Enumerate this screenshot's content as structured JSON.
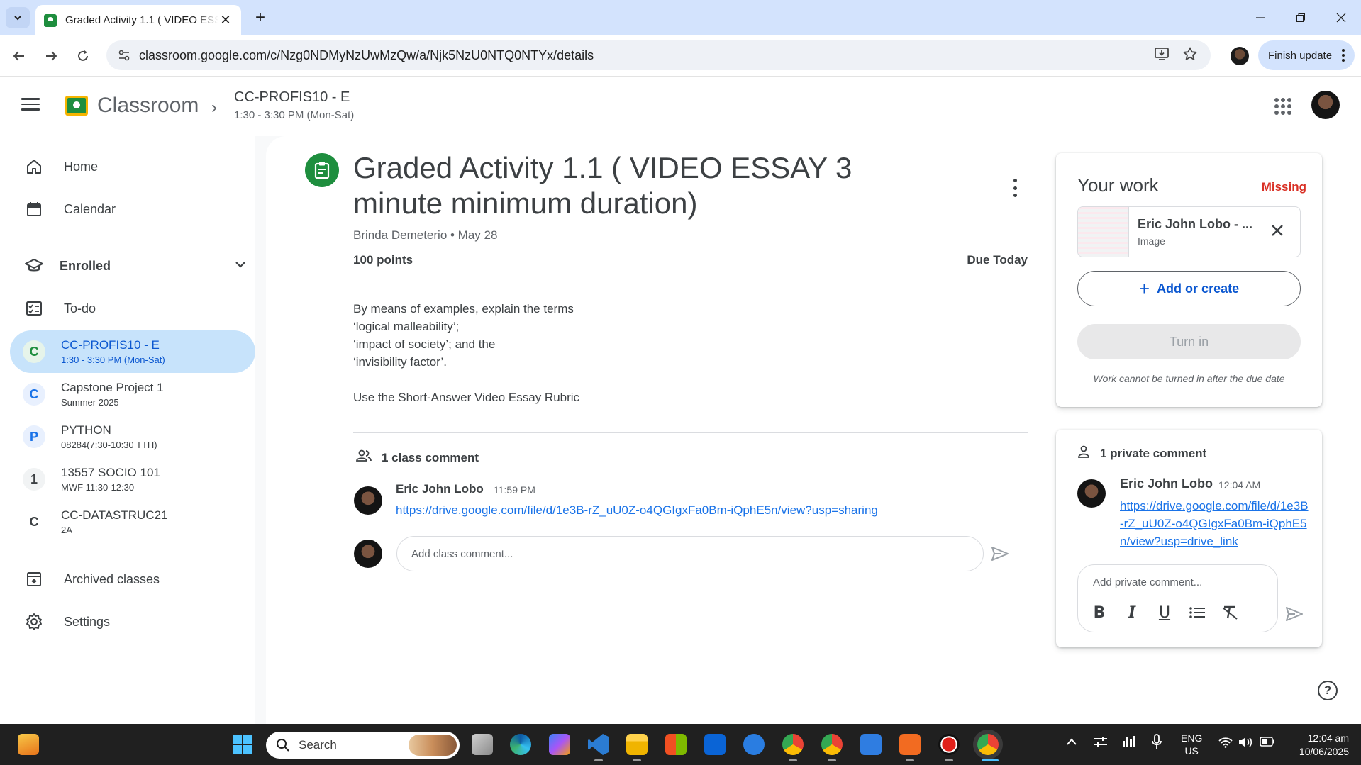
{
  "browser": {
    "tab_title": "Graded Activity 1.1 ( VIDEO ESS",
    "tab_close": "✕",
    "new_tab": "+",
    "url": "classroom.google.com/c/Nzg0NDMyNzUwMzQw/a/Njk5NzU0NTQ0NTYx/details",
    "finish_update": "Finish update"
  },
  "app": {
    "name": "Classroom",
    "class_name": "CC-PROFIS10 - E",
    "class_schedule": "1:30 - 3:30 PM (Mon-Sat)"
  },
  "sidebar": {
    "home": "Home",
    "calendar": "Calendar",
    "enrolled": "Enrolled",
    "todo": "To-do",
    "archived": "Archived classes",
    "settings": "Settings",
    "classes": [
      {
        "letter": "C",
        "name": "CC-PROFIS10 - E",
        "sub": "1:30 - 3:30 PM (Mon-Sat)",
        "color": "#1e8e3e",
        "bg": "#e6f4ea"
      },
      {
        "letter": "C",
        "name": "Capstone Project 1",
        "sub": "Summer 2025",
        "color": "#1a73e8",
        "bg": "#e8f0fe"
      },
      {
        "letter": "P",
        "name": "PYTHON",
        "sub": "08284(7:30-10:30 TTH)",
        "color": "#1a73e8",
        "bg": "#e8f0fe"
      },
      {
        "letter": "1",
        "name": "13557 SOCIO 101",
        "sub": "MWF 11:30-12:30",
        "color": "#3c4043",
        "bg": "#f1f3f4"
      },
      {
        "letter": "C",
        "name": "CC-DATASTRUC21",
        "sub": "2A",
        "color": "#3c4043",
        "bg": "#ffffff"
      }
    ]
  },
  "assignment": {
    "title": "Graded Activity 1.1 ( VIDEO ESSAY 3 minute minimum duration)",
    "author_line": "Brinda Demeterio • May 28",
    "points": "100 points",
    "due": "Due Today",
    "instructions": [
      "By means of examples, explain the terms",
      "‘logical malleability’;",
      "‘impact of society’; and the",
      "‘invisibility factor’.",
      "",
      "Use the Short-Answer Video Essay Rubric"
    ]
  },
  "class_comments": {
    "header": "1 class comment",
    "comment": {
      "author": "Eric John Lobo",
      "time": "11:59 PM",
      "link": "https://drive.google.com/file/d/1e3B-rZ_uU0Z-o4QGIgxFa0Bm-iQphE5n/view?usp=sharing"
    },
    "input_placeholder": "Add class comment..."
  },
  "your_work": {
    "title": "Your work",
    "status": "Missing",
    "status_color": "#d93025",
    "attachment_name": "Eric John Lobo - ...",
    "attachment_type": "Image",
    "add_or_create": "Add or create",
    "turn_in": "Turn in",
    "note": "Work cannot be turned in after the due date"
  },
  "private_comments": {
    "header": "1 private comment",
    "comment": {
      "author": "Eric John Lobo",
      "time": "12:04 AM",
      "link": "https://drive.google.com/file/d/1e3B-rZ_uU0Z-o4QGIgxFa0Bm-iQphE5n/view?usp=drive_link"
    },
    "input_placeholder": "Add private comment..."
  },
  "taskbar": {
    "search": "Search",
    "lang_top": "ENG",
    "lang_bottom": "US",
    "time": "12:04 am",
    "date": "10/06/2025"
  },
  "colors": {
    "accent": "#0b57d0",
    "classroom_green": "#1e8e3e",
    "link": "#1a73e8"
  }
}
